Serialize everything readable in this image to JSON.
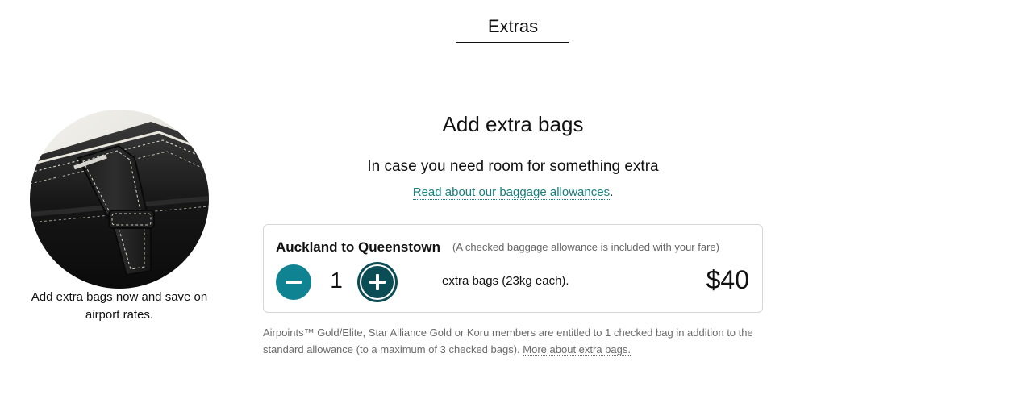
{
  "page": {
    "tab_title": "Extras"
  },
  "promo": {
    "image_icon": "leather-bag-photo",
    "caption": "Add extra bags now and save on airport rates."
  },
  "main": {
    "heading": "Add extra bags",
    "subheading": "In case you need room for something extra",
    "link_text": "Read about our baggage allowances",
    "link_suffix": "."
  },
  "flight": {
    "route": "Auckland to Queenstown",
    "note": "(A checked baggage allowance is included with your fare)",
    "quantity": "1",
    "bag_description": "extra bags (23kg each).",
    "price": "$40",
    "minus_icon": "minus-icon",
    "plus_icon": "plus-icon",
    "accent_color": "#0f8392"
  },
  "footnote": {
    "text": "Airpoints™ Gold/Elite, Star Alliance Gold or Koru members are entitled to 1 checked bag in addition to the standard allowance (to a maximum of 3 checked bags).",
    "link_text": "More about extra bags."
  }
}
